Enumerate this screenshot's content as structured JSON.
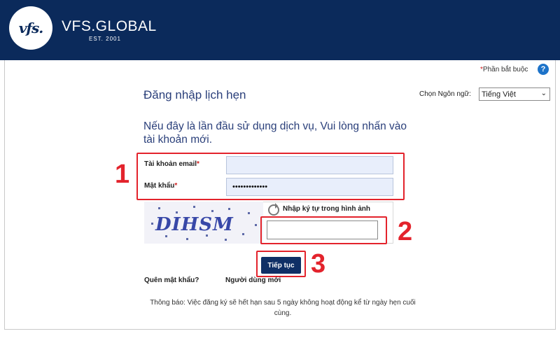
{
  "brand": {
    "logo_text": "vfs.",
    "name": "VFS.GLOBAL",
    "tagline": "EST. 2001"
  },
  "required_note": {
    "star": "*",
    "text": "Phần bắt buộc"
  },
  "help_icon_glyph": "?",
  "page_title": "Đăng nhập lịch hẹn",
  "language": {
    "label": "Chọn Ngôn ngữ:",
    "selected": "Tiếng Việt"
  },
  "intro_text": "Nếu đây là lần đầu sử dụng dịch vụ, Vui lòng nhấn vào tài khoản mới.",
  "form": {
    "email_label": "Tài khoản email",
    "password_label": "Mật khẩu",
    "required_star": "*",
    "email_value": "",
    "password_value": "•••••••••••••"
  },
  "captcha": {
    "image_text": "DIHSM",
    "label": "Nhập ký tự trong hình ảnh",
    "value": ""
  },
  "continue_label": "Tiếp tục",
  "links": {
    "forgot_password": "Quên mật khẩu?",
    "new_user": "Người dùng mới"
  },
  "notice": "Thông báo: Việc đăng ký sẽ hết hạn sau 5 ngày không hoạt động kể từ ngày hẹn cuối cùng.",
  "annotations": [
    "1",
    "2",
    "3"
  ],
  "colors": {
    "header": "#0b2a5b",
    "annotation": "#e3232c",
    "button": "#0f2f66",
    "input_fill": "#e8eefb"
  }
}
